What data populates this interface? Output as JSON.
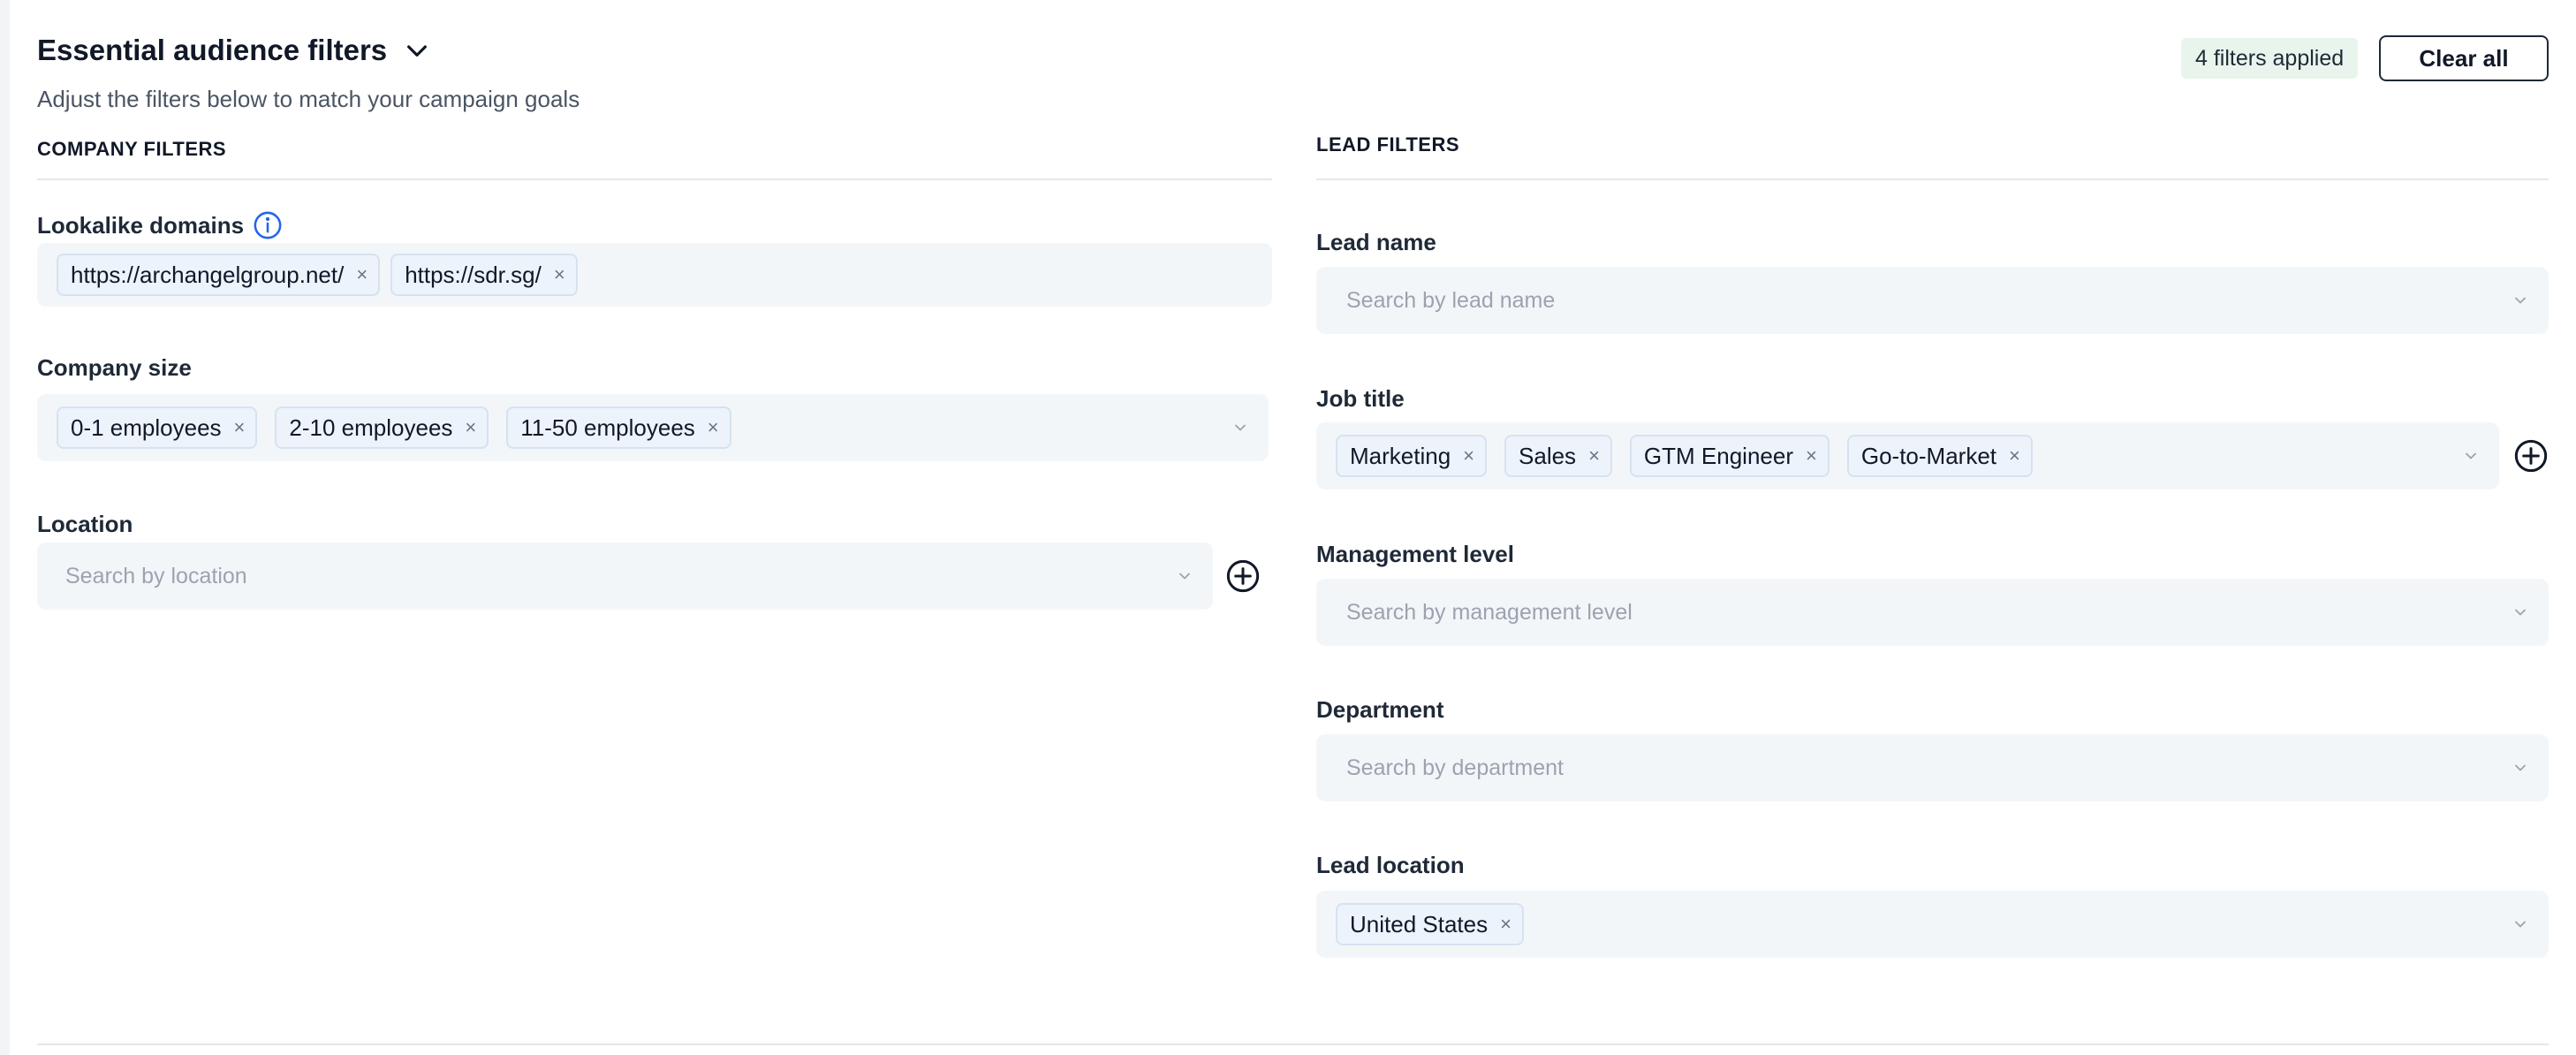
{
  "header": {
    "title": "Essential audience filters",
    "subtitle": "Adjust the filters below to match your campaign goals",
    "filters_applied": "4 filters applied",
    "clear_all_label": "Clear all"
  },
  "company_filters": {
    "section_label": "COMPANY FILTERS",
    "lookalike_domains": {
      "label": "Lookalike domains",
      "chips": [
        "https://archangelgroup.net/",
        "https://sdr.sg/"
      ]
    },
    "company_size": {
      "label": "Company size",
      "chips": [
        "0-1 employees",
        "2-10 employees",
        "11-50 employees"
      ]
    },
    "location": {
      "label": "Location",
      "placeholder": "Search by location"
    }
  },
  "lead_filters": {
    "section_label": "LEAD FILTERS",
    "lead_name": {
      "label": "Lead name",
      "placeholder": "Search by lead name"
    },
    "job_title": {
      "label": "Job title",
      "chips": [
        "Marketing",
        "Sales",
        "GTM Engineer",
        "Go-to-Market"
      ]
    },
    "management_level": {
      "label": "Management level",
      "placeholder": "Search by management level"
    },
    "department": {
      "label": "Department",
      "placeholder": "Search by department"
    },
    "lead_location": {
      "label": "Lead location",
      "chips": [
        "United States"
      ]
    }
  },
  "icons": {
    "remove": "×",
    "title_toggle": "chevron-down-icon",
    "dropdown": "chevron-down-icon",
    "add": "plus-circle-icon",
    "info": "info-circle-icon"
  },
  "colors": {
    "accent": "#2563eb",
    "badge_bg": "#e9f4ec",
    "field_bg": "#f3f6f9",
    "chip_bg": "#edf3fb"
  }
}
